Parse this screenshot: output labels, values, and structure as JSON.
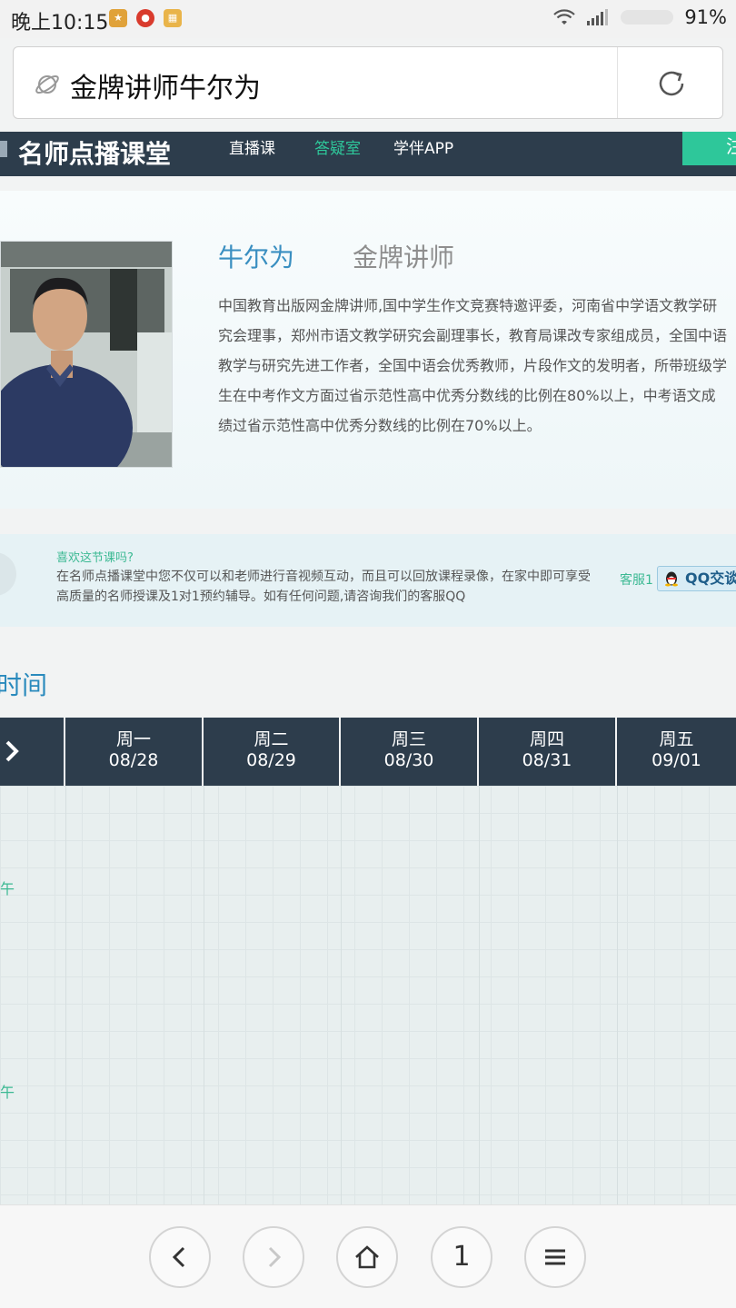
{
  "status_bar": {
    "time": "晚上10:15",
    "battery": "91%",
    "apps": [
      "app-icon-1",
      "app-icon-2",
      "app-icon-3"
    ]
  },
  "url_bar": {
    "query": "金牌讲师牛尔为"
  },
  "site": {
    "title": "名师点播课堂",
    "nav": [
      "直播课",
      "答疑室",
      "学伴APP"
    ],
    "active_nav": "答疑室",
    "accent_color": "#2ec79a",
    "header_color": "#2d3d4c",
    "header_button": "注"
  },
  "teacher": {
    "name": "牛尔为",
    "title": "金牌讲师",
    "bio": "中国教育出版网金牌讲师,国中学生作文竞赛特邀评委，河南省中学语文教学研究会理事，郑州市语文教学研究会副理事长，教育局课改专家组成员，全国中语教学与研究先进工作者，全国中语会优秀教师，片段作文的发明者，所带班级学生在中考作文方面过省示范性高中优秀分数线的比例在80%以上，中考语文成绩过省示范性高中优秀分数线的比例在70%以上。"
  },
  "help": {
    "question": "喜欢这节课吗?",
    "text": "在名师点播课堂中您不仅可以和老师进行音视频互动，而且可以回放课程录像，在家中即可享受高质量的名师授课及1对1预约辅导。如有任何问题,请咨询我们的客服QQ",
    "service_label": "客服1",
    "qq_button": "QQ交谈"
  },
  "schedule": {
    "title": "时间",
    "days": [
      {
        "name": "周一",
        "date": "08/28"
      },
      {
        "name": "周二",
        "date": "08/29"
      },
      {
        "name": "周三",
        "date": "08/30"
      },
      {
        "name": "周四",
        "date": "08/31"
      },
      {
        "name": "周五",
        "date": "09/01"
      }
    ],
    "periods": [
      "午",
      "午"
    ]
  },
  "bottom_bar": {
    "tab_count": "1"
  }
}
